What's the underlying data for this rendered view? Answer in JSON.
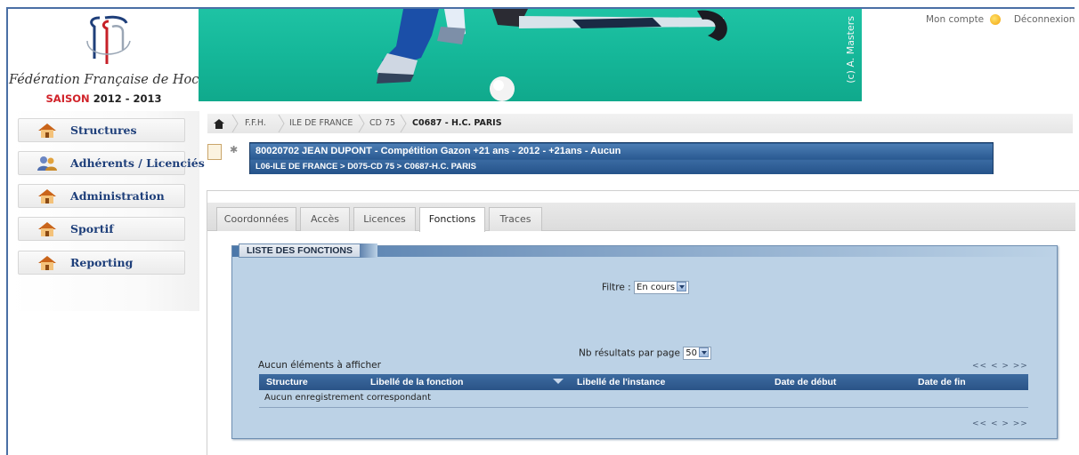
{
  "logo": {
    "name": "Fédération Française de Hockey",
    "season_label": "SAISON",
    "season_years": "2012 - 2013"
  },
  "banner": {
    "credit": "(c) A. Masters"
  },
  "account": {
    "my_account": "Mon compte",
    "logout": "Déconnexion"
  },
  "sidebar": {
    "items": [
      {
        "label": "Structures"
      },
      {
        "label": "Adhérents / Licenciés"
      },
      {
        "label": "Administration"
      },
      {
        "label": "Sportif"
      },
      {
        "label": "Reporting"
      }
    ]
  },
  "breadcrumb": [
    "F.F.H.",
    "ILE DE FRANCE",
    "CD 75",
    "C0687 - H.C. PARIS"
  ],
  "header": {
    "line1": "80020702 JEAN DUPONT - Compétition Gazon +21 ans - 2012 - +21ans - Aucun",
    "line2": "L06-ILE DE FRANCE > D075-CD 75 > C0687-H.C. PARIS"
  },
  "tabs": [
    {
      "label": "Coordonnées",
      "active": false
    },
    {
      "label": "Accès",
      "active": false
    },
    {
      "label": "Licences",
      "active": false
    },
    {
      "label": "Fonctions",
      "active": true
    },
    {
      "label": "Traces",
      "active": false
    }
  ],
  "panel": {
    "title": "LISTE DES FONCTIONS",
    "filter_label": "Filtre :",
    "filter_value": "En cours",
    "per_page_label": "Nb résultats par page",
    "per_page_value": "50",
    "empty_message": "Aucun éléments à afficher",
    "pager": "<< < > >>",
    "columns": [
      "Structure",
      "Libellé de la fonction",
      "Libellé de l'instance",
      "Date de début",
      "Date de fin"
    ],
    "no_records": "Aucun enregistrement correspondant"
  },
  "colors": {
    "border_blue": "#4a6fa5",
    "header_blue": "#2f5f95",
    "panel_bg": "#bcd2e6",
    "menu_text": "#1e3f7a",
    "season_red": "#d1232a"
  }
}
